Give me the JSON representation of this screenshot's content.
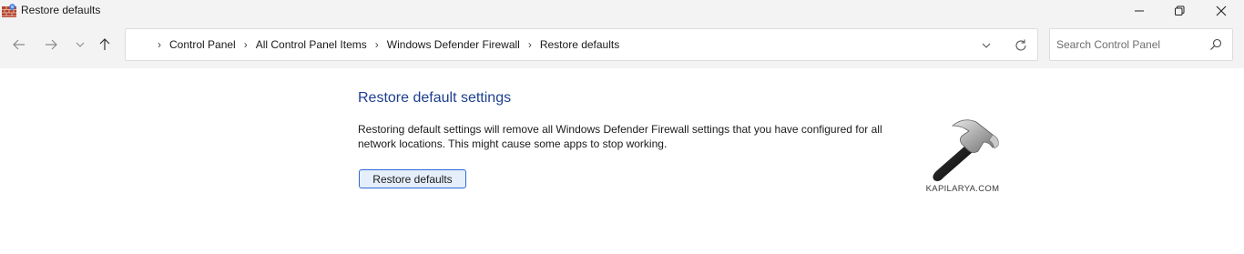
{
  "window": {
    "title": "Restore defaults",
    "icon": "firewall-brick-icon"
  },
  "titlebar_buttons": [
    "minimize-icon",
    "maximize-icon",
    "close-icon"
  ],
  "nav": {
    "buttons": [
      "back-arrow-icon",
      "forward-arrow-icon",
      "recent-locations-chevron-icon",
      "up-arrow-icon"
    ],
    "breadcrumb": [
      "Control Panel",
      "All Control Panel Items",
      "Windows Defender Firewall",
      "Restore defaults"
    ],
    "search_placeholder": "Search Control Panel"
  },
  "content": {
    "title": "Restore default settings",
    "description": "Restoring default settings will remove all Windows Defender Firewall settings that you have configured for all network locations. This might cause some apps to stop working.",
    "restore_button_label": "Restore defaults"
  },
  "watermark": {
    "icon": "hammer-icon",
    "text": "KAPILARYA.COM"
  },
  "colors": {
    "title": "#1e3f8f",
    "button_border": "#2c6ad6",
    "button_fill": "#e5effb",
    "chrome": "#f3f3f3"
  }
}
